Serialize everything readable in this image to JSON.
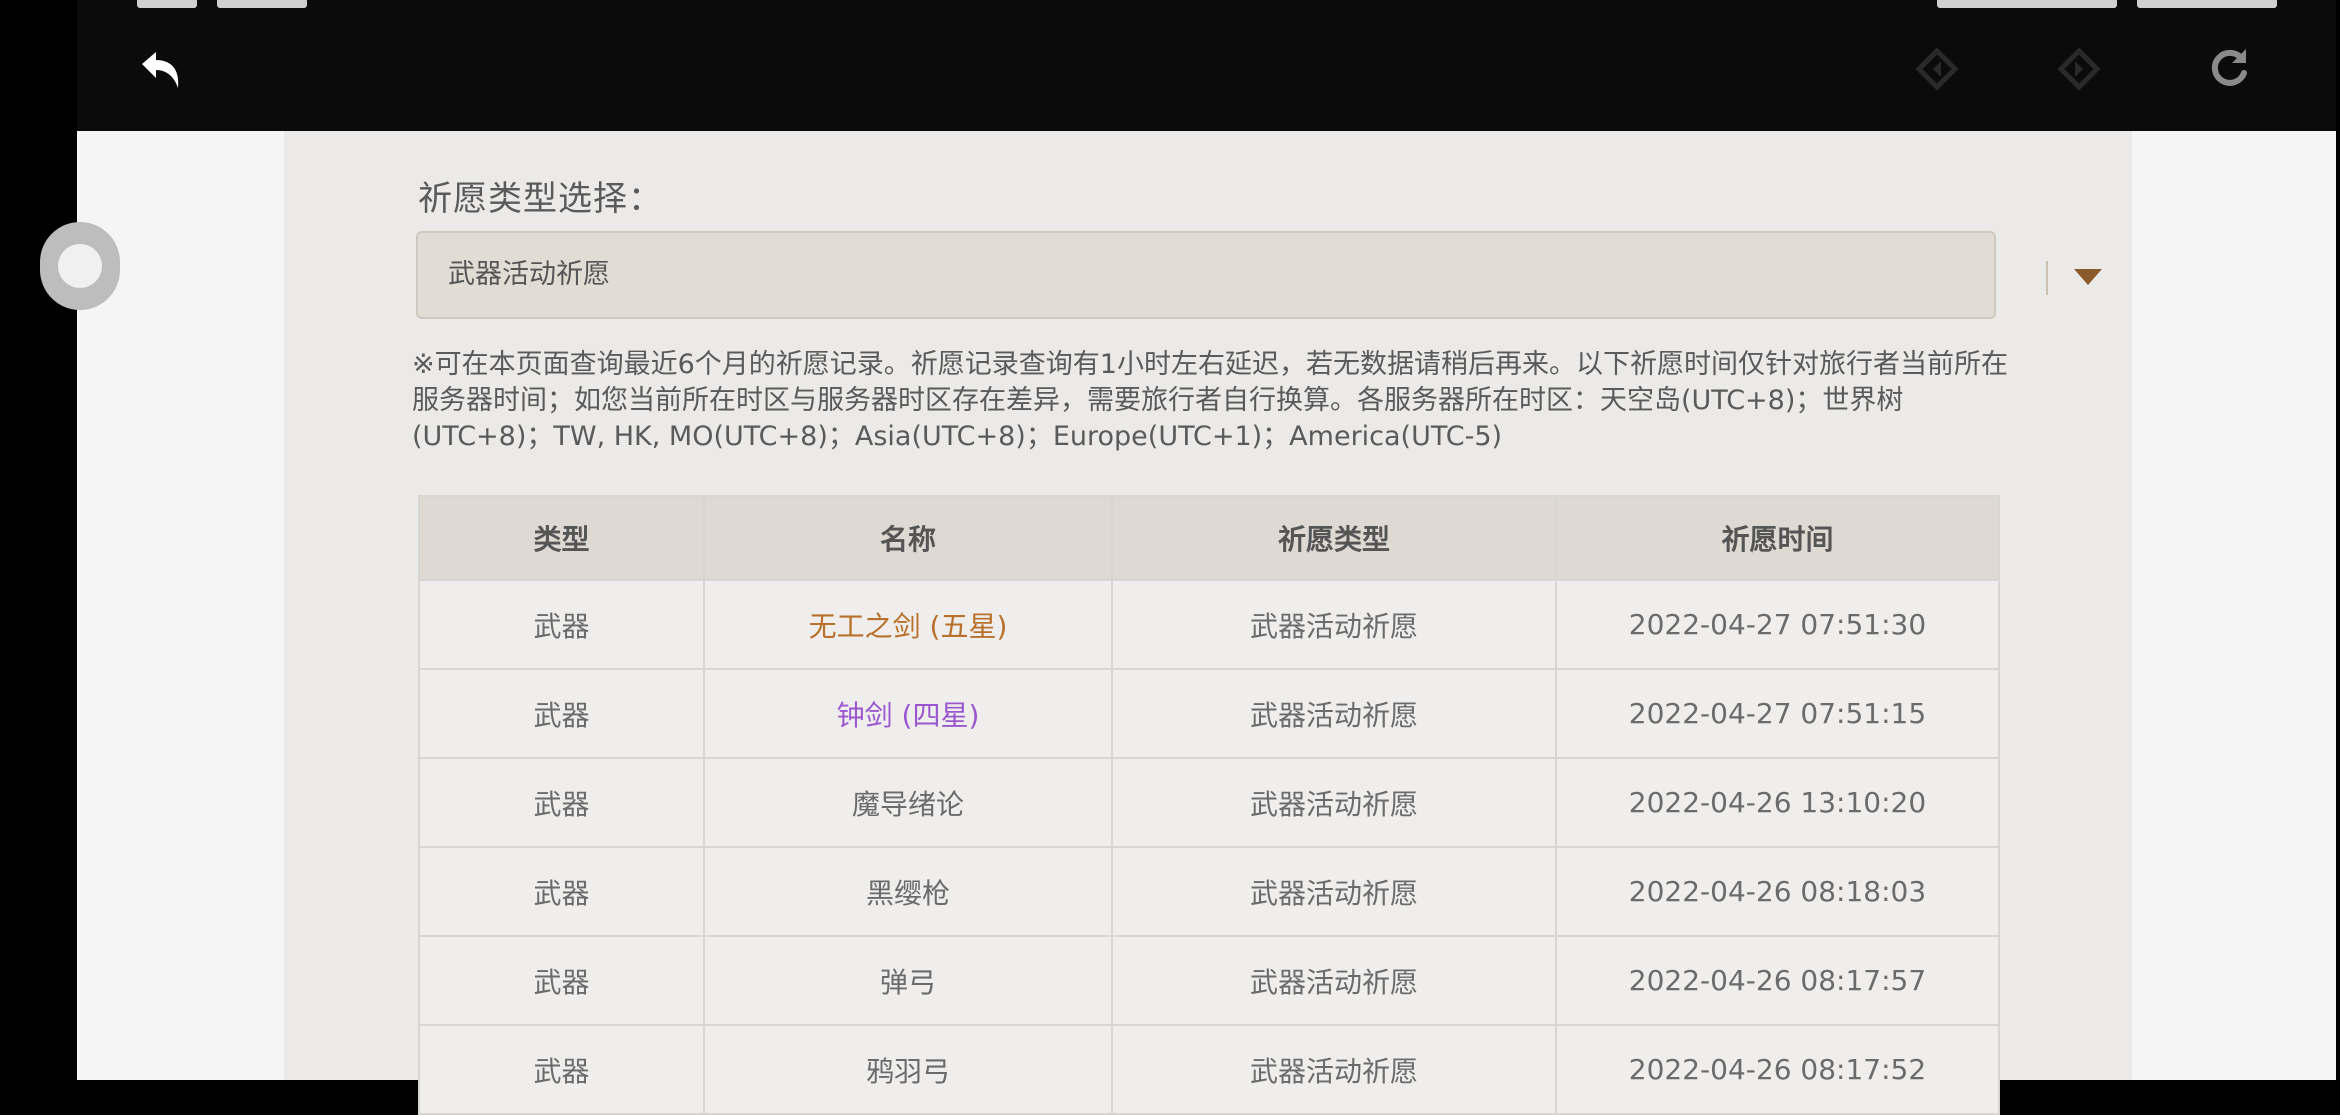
{
  "colors": {
    "five_star": "#b8702a",
    "four_star": "#9a57d0",
    "header_bg": "#dedad3",
    "select_bg": "#e2ddd4"
  },
  "nav": {
    "back_icon": "back-arrow-icon",
    "prev_icon": "diamond-left-icon",
    "next_icon": "diamond-right-icon",
    "refresh_icon": "refresh-icon"
  },
  "page": {
    "type_label": "祈愿类型选择：",
    "select_value": "武器活动祈愿",
    "notice": "※可在本页面查询最近6个月的祈愿记录。祈愿记录查询有1小时左右延迟，若无数据请稍后再来。以下祈愿时间仅针对旅行者当前所在服务器时间；如您当前所在时区与服务器时区存在差异，需要旅行者自行换算。各服务器所在时区：天空岛(UTC+8)；世界树(UTC+8)；TW, HK, MO(UTC+8)；Asia(UTC+8)；Europe(UTC+1)；America(UTC-5)"
  },
  "table": {
    "headers": [
      "类型",
      "名称",
      "祈愿类型",
      "祈愿时间"
    ],
    "rows": [
      {
        "type": "武器",
        "name": "无工之剑 (五星)",
        "wish": "武器活动祈愿",
        "time": "2022-04-27 07:51:30"
      },
      {
        "type": "武器",
        "name": "钟剑 (四星)",
        "wish": "武器活动祈愿",
        "time": "2022-04-27 07:51:15"
      },
      {
        "type": "武器",
        "name": "魔导绪论",
        "wish": "武器活动祈愿",
        "time": "2022-04-26 13:10:20"
      },
      {
        "type": "武器",
        "name": "黑缨枪",
        "wish": "武器活动祈愿",
        "time": "2022-04-26 08:18:03"
      },
      {
        "type": "武器",
        "name": "弹弓",
        "wish": "武器活动祈愿",
        "time": "2022-04-26 08:17:57"
      },
      {
        "type": "武器",
        "name": "鸦羽弓",
        "wish": "武器活动祈愿",
        "time": "2022-04-26 08:17:52"
      }
    ]
  }
}
